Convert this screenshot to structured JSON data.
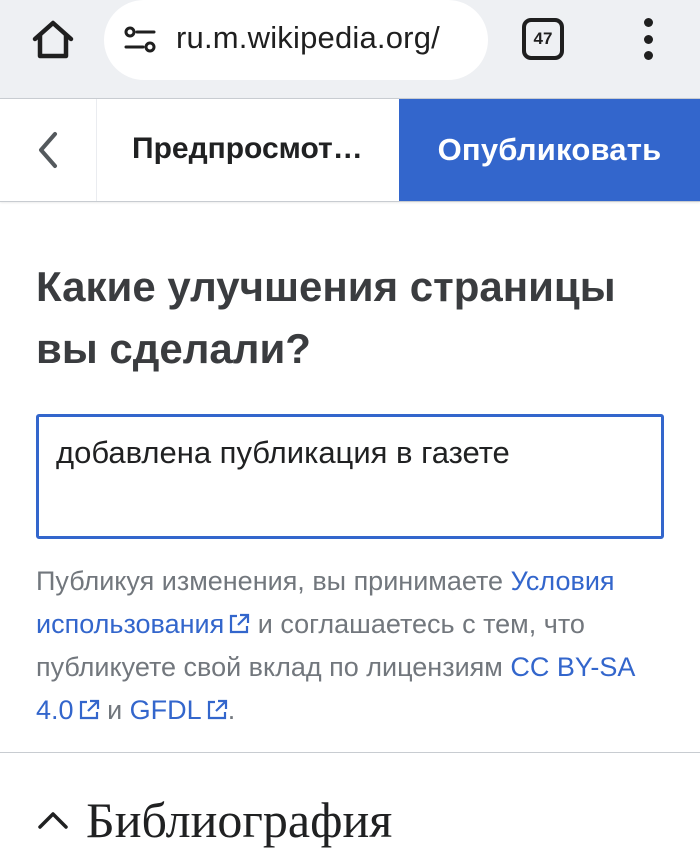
{
  "browser": {
    "url": "ru.m.wikipedia.org/",
    "tab_count": "47",
    "icons": [
      "home-icon",
      "site-settings-icon",
      "tab-switcher-icon",
      "more-vert-icon"
    ]
  },
  "toolbar": {
    "title": "Предпросмот…",
    "publish_label": "Опубликовать"
  },
  "main": {
    "question": "Какие улучшения страницы вы сделали?",
    "summary_value": "добавлена публикация в газете",
    "license": {
      "text_1": "Публикуя изменения, вы принимаете",
      "terms_link": "Условия использования",
      "text_2": "и соглашаетесь с тем, что публикуете свой вклад по лицензиям",
      "cc_link": "CC BY-SA 4.0",
      "text_3": "и",
      "gfdl_link": "GFDL",
      "text_4": "."
    }
  },
  "section": {
    "title": "Библиография"
  },
  "colors": {
    "accent": "#3366cc",
    "chrome_bg": "#eef0f3",
    "muted_text": "#72777d"
  }
}
